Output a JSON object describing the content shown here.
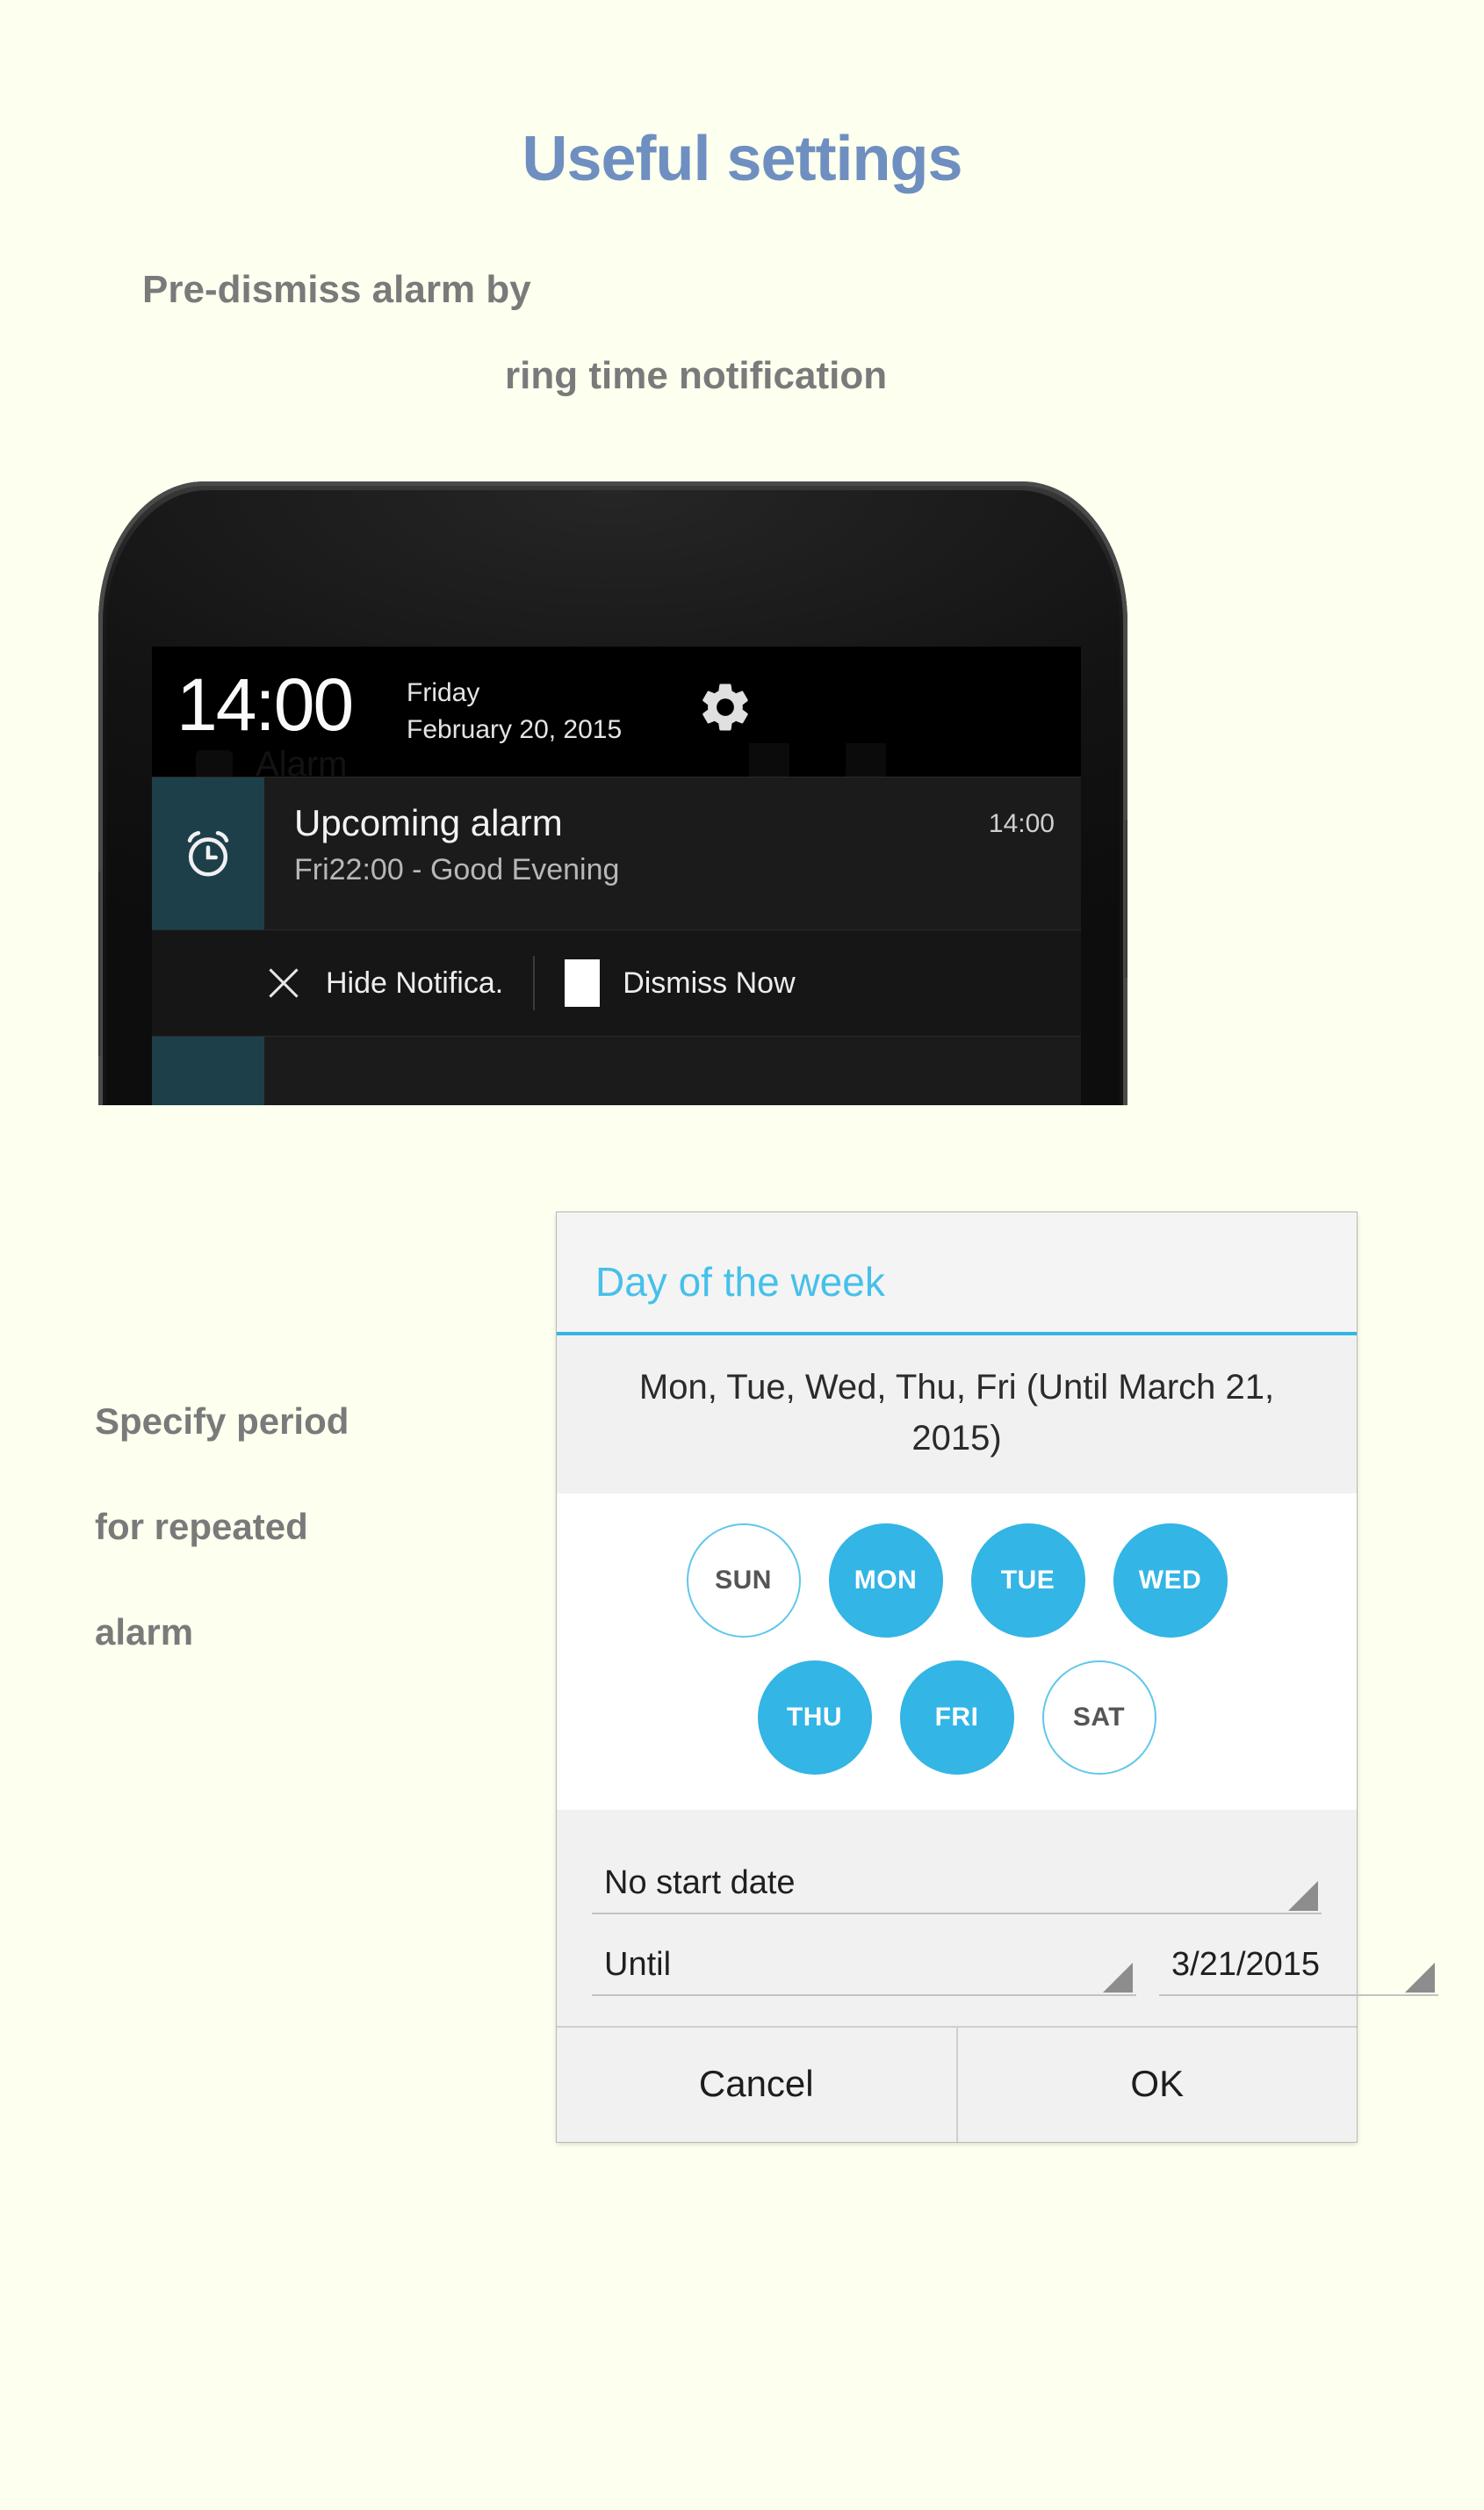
{
  "page": {
    "title": "Useful settings",
    "subtitle_line1": "Pre-dismiss alarm by",
    "subtitle_line2": "ring time notification",
    "title_color": "#6e8fc0",
    "background_color": "#fdffef"
  },
  "annotation": {
    "line1": "Specify period",
    "line2": "for repeated",
    "line3": "alarm"
  },
  "phone": {
    "statusbar": {
      "time": "14:00",
      "weekday": "Friday",
      "date": "February 20, 2015",
      "gear_icon": "gear-icon"
    },
    "background_item": {
      "label": "Alarm"
    },
    "notification": {
      "icon": "alarm-clock-icon",
      "icon_panel_color": "#1d3f4a",
      "title": "Upcoming alarm",
      "subtitle": "Fri22:00 - Good Evening",
      "time": "14:00",
      "actions": [
        {
          "icon": "close-x-icon",
          "label": "Hide Notifica."
        },
        {
          "icon": "stop-square-icon",
          "label": "Dismiss Now"
        }
      ]
    }
  },
  "dialog": {
    "title": "Day of the week",
    "accent_color": "#33b5e5",
    "summary": "Mon, Tue, Wed, Thu, Fri (Until March 21, 2015)",
    "days_row1": [
      {
        "label": "SUN",
        "selected": false
      },
      {
        "label": "MON",
        "selected": true
      },
      {
        "label": "TUE",
        "selected": true
      },
      {
        "label": "WED",
        "selected": true
      }
    ],
    "days_row2": [
      {
        "label": "THU",
        "selected": true
      },
      {
        "label": "FRI",
        "selected": true
      },
      {
        "label": "SAT",
        "selected": false
      }
    ],
    "start_field": "No start date",
    "until_label": "Until",
    "until_date": "3/21/2015",
    "cancel_label": "Cancel",
    "ok_label": "OK"
  }
}
